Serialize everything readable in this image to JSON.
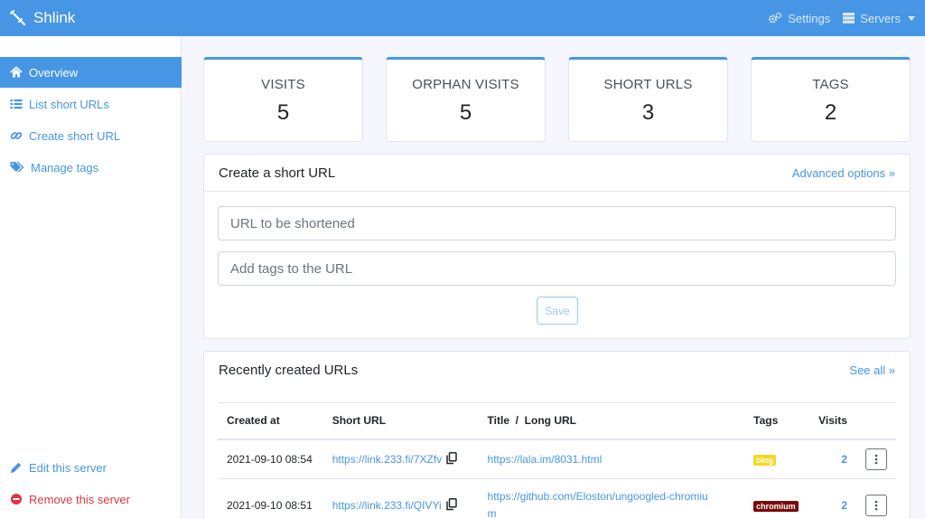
{
  "header": {
    "app_name": "Shlink",
    "settings_label": "Settings",
    "servers_label": "Servers",
    "brand_color": "#4696e5"
  },
  "sidebar": {
    "items": [
      {
        "label": "Overview",
        "icon": "home-icon",
        "active": true
      },
      {
        "label": "List short URLs",
        "icon": "list-icon"
      },
      {
        "label": "Create short URL",
        "icon": "link-icon"
      },
      {
        "label": "Manage tags",
        "icon": "tags-icon"
      }
    ],
    "edit_server": "Edit this server",
    "remove_server": "Remove this server"
  },
  "stats": [
    {
      "label": "VISITS",
      "value": "5"
    },
    {
      "label": "ORPHAN VISITS",
      "value": "5"
    },
    {
      "label": "SHORT URLS",
      "value": "3"
    },
    {
      "label": "TAGS",
      "value": "2"
    }
  ],
  "create": {
    "title": "Create a short URL",
    "advanced_link": "Advanced options »",
    "url_placeholder": "URL to be shortened",
    "tags_placeholder": "Add tags to the URL",
    "save_label": "Save"
  },
  "recent": {
    "title": "Recently created URLs",
    "see_all": "See all »",
    "columns": [
      "Created at",
      "Short URL",
      "Title  /  Long URL",
      "Tags",
      "Visits"
    ],
    "rows": [
      {
        "created": "2021-09-10 08:54",
        "short_url": "https://link.233.fi/7XZfv",
        "long_url": "https://lala.im/8031.html",
        "tag": "blog",
        "tag_color": "#f5d81e",
        "visits": "2"
      },
      {
        "created": "2021-09-10 08:51",
        "short_url": "https://link.233.fi/QIVYi",
        "long_url": "https://github.com/Eloston/ungoogled-chromiu\nm",
        "tag": "chromium",
        "tag_color": "#7a0a0a",
        "visits": "2"
      }
    ]
  }
}
